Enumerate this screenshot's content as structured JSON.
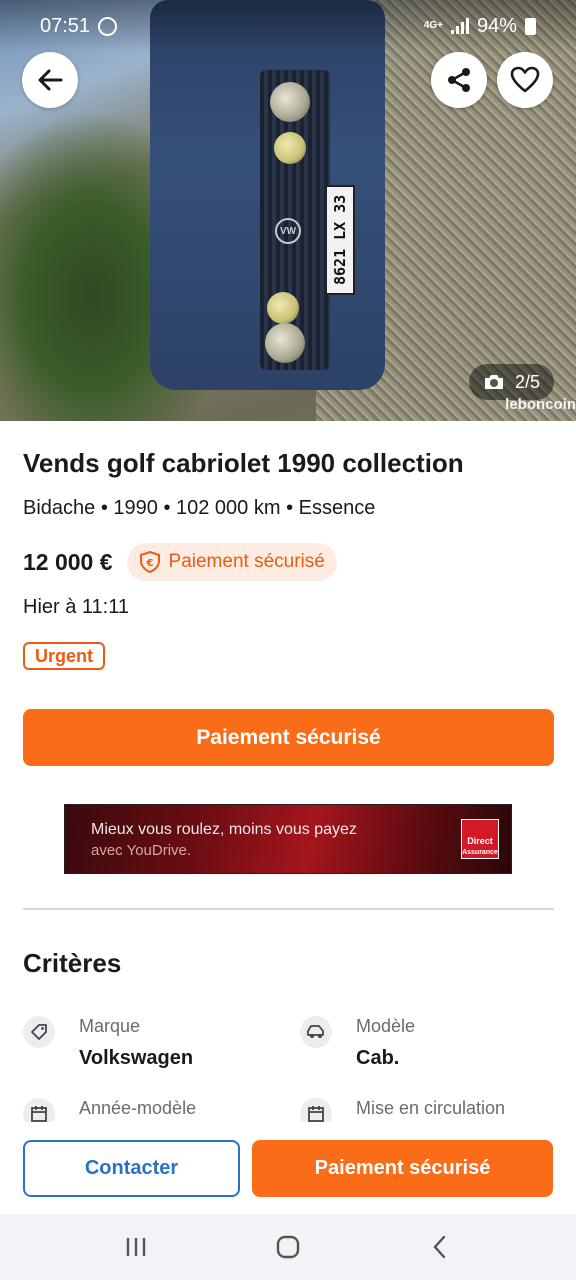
{
  "status_bar": {
    "time": "07:51",
    "network": "4G+",
    "battery": "94%"
  },
  "photo": {
    "counter": "2/5",
    "watermark": "leboncoin",
    "plate": "8621 LX 33",
    "vw_logo": "VW"
  },
  "listing": {
    "title": "Vends golf cabriolet 1990 collection",
    "subtitle": "Bidache • 1990 • 102 000 km • Essence",
    "price": "12 000 €",
    "secure_badge": "Paiement sécurisé",
    "date": "Hier à 11:11",
    "urgent_tag": "Urgent",
    "pay_button": "Paiement sécurisé"
  },
  "ad": {
    "line1": "Mieux vous roulez, moins vous payez",
    "line2": "avec YouDrive.",
    "logo_line1": "Direct",
    "logo_line2": "Assurance"
  },
  "criteria": {
    "title": "Critères",
    "items": [
      {
        "label": "Marque",
        "value": "Volkswagen",
        "icon": "tag-icon"
      },
      {
        "label": "Modèle",
        "value": "Cab.",
        "icon": "car-icon"
      },
      {
        "label": "Année-modèle",
        "value": "",
        "icon": "calendar-icon"
      },
      {
        "label": "Mise en circulation",
        "value": "",
        "icon": "calendar-icon"
      }
    ]
  },
  "actions": {
    "contact": "Contacter",
    "pay": "Paiement sécurisé"
  },
  "colors": {
    "accent": "#fb6c18",
    "link_blue": "#2b72c6",
    "badge_bg": "#feece2"
  }
}
